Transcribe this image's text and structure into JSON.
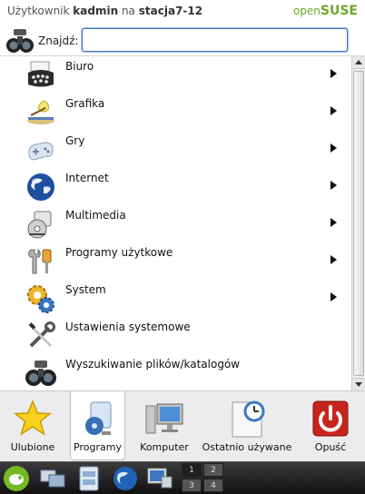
{
  "header": {
    "user_prefix": "Użytkownik",
    "username": "kadmin",
    "host_prefix": "na",
    "hostname": "stacja7-12",
    "brand_light": "open",
    "brand_bold": "SUSE"
  },
  "search": {
    "label": "Znajdź:",
    "value": "",
    "placeholder": ""
  },
  "menu": {
    "items": [
      {
        "label": "Biuro",
        "icon": "office-typewriter-icon",
        "submenu": true
      },
      {
        "label": "Grafika",
        "icon": "graphics-icon",
        "submenu": true
      },
      {
        "label": "Gry",
        "icon": "gamepad-icon",
        "submenu": true
      },
      {
        "label": "Internet",
        "icon": "globe-icon",
        "submenu": true
      },
      {
        "label": "Multimedia",
        "icon": "multimedia-icon",
        "submenu": true
      },
      {
        "label": "Programy użytkowe",
        "icon": "utilities-icon",
        "submenu": true
      },
      {
        "label": "System",
        "icon": "system-gears-icon",
        "submenu": true
      },
      {
        "label": "Ustawienia systemowe",
        "icon": "settings-tools-icon",
        "submenu": false
      },
      {
        "label": "Wyszukiwanie plików/katalogów",
        "icon": "binoculars-icon",
        "submenu": false
      }
    ]
  },
  "tabs": [
    {
      "label": "Ulubione",
      "icon": "star-icon",
      "active": false
    },
    {
      "label": "Programy",
      "icon": "applications-icon",
      "active": true
    },
    {
      "label": "Komputer",
      "icon": "computer-icon",
      "active": false
    },
    {
      "label": "Ostatnio używane",
      "icon": "recent-clock-icon",
      "active": false
    },
    {
      "label": "Opuść",
      "icon": "power-icon",
      "active": false
    }
  ],
  "taskbar": {
    "pager": [
      "1",
      "2",
      "3",
      "4"
    ],
    "active_desktop": "1"
  },
  "colors": {
    "brand_green": "#6fa62a",
    "search_border": "#3d74b8",
    "taskbar_bg": "#1a1a1a"
  }
}
